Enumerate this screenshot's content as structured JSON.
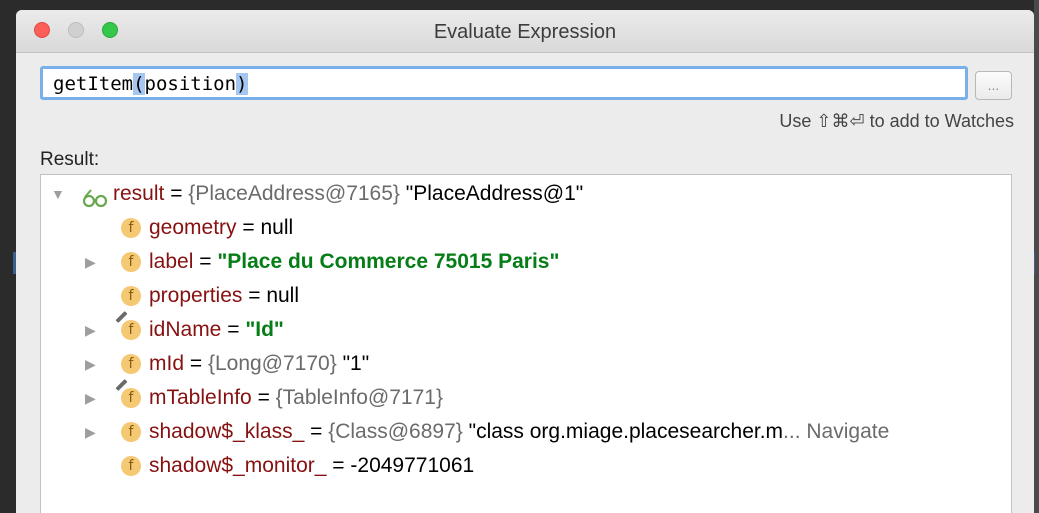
{
  "window": {
    "title": "Evaluate Expression"
  },
  "expression": {
    "value_prefix": "getItem",
    "value_open_paren": "(",
    "value_arg": "position",
    "value_close_paren": ")",
    "more_button_label": "..."
  },
  "hint": "Use ⇧⌘⏎ to add to Watches",
  "result_label": "Result:",
  "tree": {
    "rows": [
      {
        "expanded": true,
        "icon": "watch-glasses-icon",
        "name": "result",
        "eq": " = ",
        "type": "{PlaceAddress@7165}",
        "value": " \"PlaceAddress@1\""
      },
      {
        "expandable": false,
        "icon": "field-icon",
        "name": "geometry",
        "eq": " = ",
        "value": "null"
      },
      {
        "expandable": true,
        "icon": "field-icon",
        "name": "label",
        "eq": " = ",
        "string": "\"Place du Commerce 75015 Paris\""
      },
      {
        "expandable": false,
        "icon": "field-icon",
        "name": "properties",
        "eq": " = ",
        "value": "null"
      },
      {
        "expandable": true,
        "icon": "final-field-icon",
        "name": "idName",
        "eq": " = ",
        "string": "\"Id\""
      },
      {
        "expandable": true,
        "icon": "field-icon",
        "name": "mId",
        "eq": " = ",
        "type": "{Long@7170}",
        "value": " \"1\""
      },
      {
        "expandable": true,
        "icon": "final-field-icon",
        "name": "mTableInfo",
        "eq": " = ",
        "type": "{TableInfo@7171}"
      },
      {
        "expandable": true,
        "icon": "field-icon",
        "name": "shadow$_klass_",
        "eq": " = ",
        "type": "{Class@6897}",
        "value": " \"class org.miage.placesearcher.m",
        "nav": "... Navigate"
      },
      {
        "expandable": false,
        "icon": "field-icon",
        "name": "shadow$_monitor_",
        "eq": " = ",
        "value": "-2049771061"
      }
    ]
  },
  "icons": {
    "field_letter": "f",
    "tree_expanded": "▼",
    "tree_collapsed": "▶"
  },
  "colors": {
    "field_name": "#871111",
    "string_value": "#067d17",
    "type_text": "#6b6b6b",
    "focus_border": "#7ab0ea",
    "close": "#fc5f57",
    "minimize": "#d0d0d0",
    "maximize": "#34c84a"
  }
}
